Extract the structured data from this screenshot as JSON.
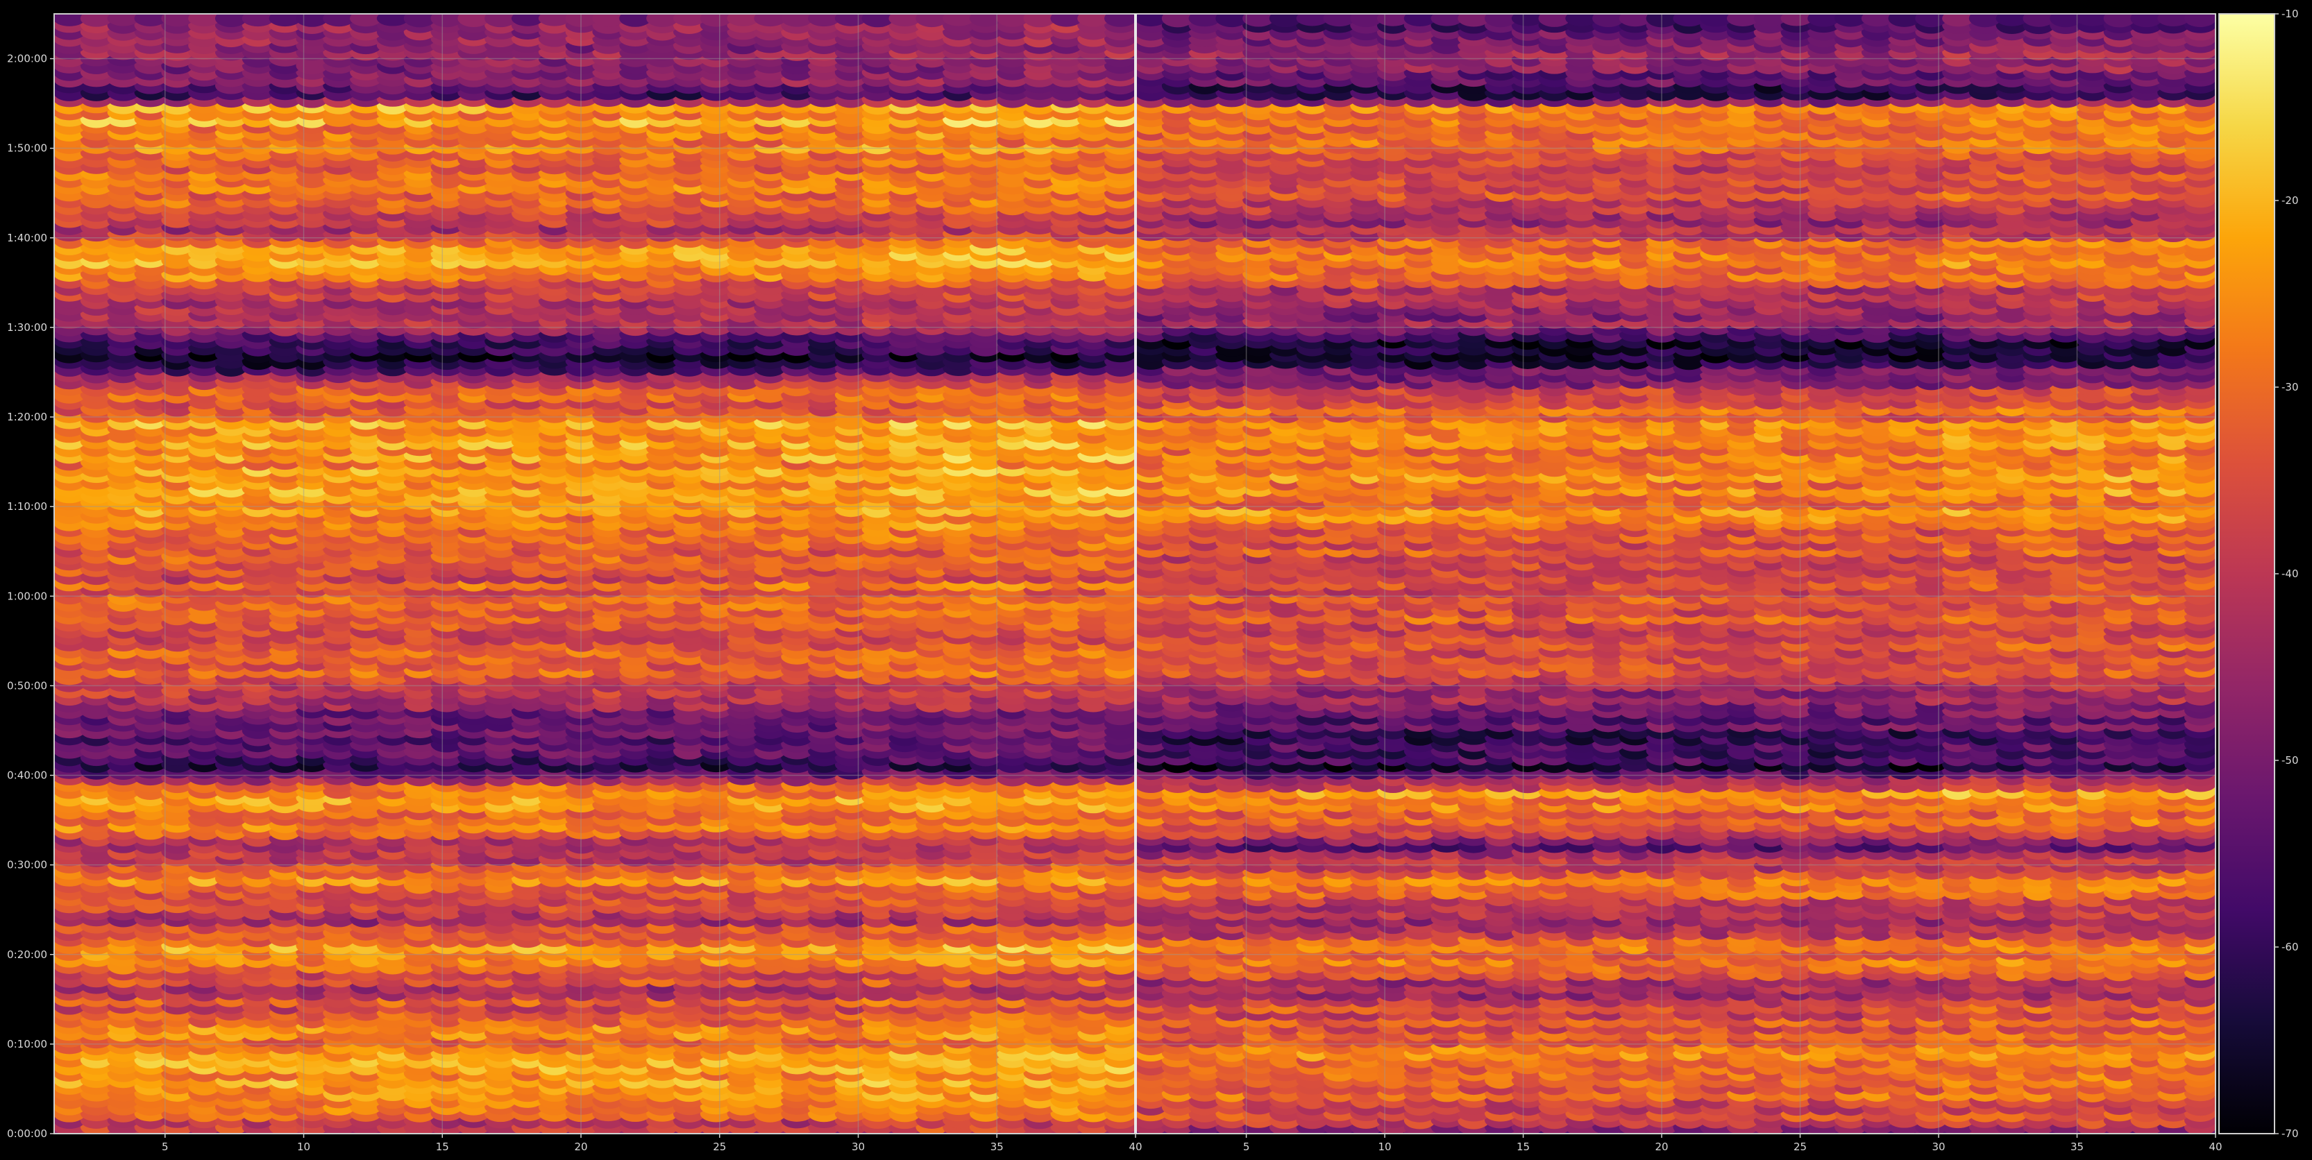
{
  "chart_data": {
    "type": "heatmap",
    "mark_style": "ellipse-grid",
    "colormap": "inferno",
    "background": "#000000",
    "grid": true,
    "panels": [
      {
        "xlim": [
          1,
          40
        ],
        "x_ticks": [
          5,
          10,
          15,
          20,
          25,
          30,
          35,
          40
        ],
        "x_tick_labels": [
          "5",
          "10",
          "15",
          "20",
          "25",
          "30",
          "35",
          "40"
        ],
        "ylim": [
          0,
          7500
        ],
        "y_ticks": [
          0,
          600,
          1200,
          1800,
          2400,
          3000,
          3600,
          4200,
          4800,
          5400,
          6000,
          6600,
          7200
        ],
        "y_tick_labels": [
          "0:00:00",
          "0:10:00",
          "0:20:00",
          "0:30:00",
          "0:40:00",
          "0:50:00",
          "1:00:00",
          "1:10:00",
          "1:20:00",
          "1:30:00",
          "1:40:00",
          "1:50:00",
          "2:00:00"
        ]
      },
      {
        "xlim": [
          1,
          40
        ],
        "x_ticks": [
          5,
          10,
          15,
          20,
          25,
          30,
          35,
          40
        ],
        "x_tick_labels": [
          "5",
          "10",
          "15",
          "20",
          "25",
          "30",
          "35",
          "40"
        ],
        "ylim": [
          0,
          7500
        ],
        "y_ticks": [
          0,
          600,
          1200,
          1800,
          2400,
          3000,
          3600,
          4200,
          4800,
          5400,
          6000,
          6600,
          7200
        ],
        "y_tick_labels": []
      }
    ],
    "colorbar": {
      "range": [
        -70,
        -10
      ],
      "ticks": [
        -70,
        -60,
        -50,
        -40,
        -30,
        -20,
        -10
      ],
      "tick_labels": [
        "-70",
        "-60",
        "-50",
        "-40",
        "-30",
        "-20",
        "-10"
      ]
    },
    "row_profile": {
      "description_values_dB_by_time": [
        [
          0,
          -45
        ],
        [
          120,
          -35
        ],
        [
          250,
          -30
        ],
        [
          400,
          -24
        ],
        [
          520,
          -26
        ],
        [
          700,
          -28
        ],
        [
          900,
          -36
        ],
        [
          1000,
          -40
        ],
        [
          1150,
          -30
        ],
        [
          1260,
          -25
        ],
        [
          1350,
          -34
        ],
        [
          1450,
          -42
        ],
        [
          1550,
          -36
        ],
        [
          1700,
          -26
        ],
        [
          1850,
          -38
        ],
        [
          1950,
          -48
        ],
        [
          2050,
          -30
        ],
        [
          2300,
          -24
        ],
        [
          2450,
          -60
        ],
        [
          2600,
          -54
        ],
        [
          2800,
          -52
        ],
        [
          2950,
          -42
        ],
        [
          3100,
          -32
        ],
        [
          3350,
          -34
        ],
        [
          3550,
          -30
        ],
        [
          3750,
          -34
        ],
        [
          3950,
          -30
        ],
        [
          4300,
          -22
        ],
        [
          4500,
          -26
        ],
        [
          4750,
          -24
        ],
        [
          5000,
          -36
        ],
        [
          5200,
          -62
        ],
        [
          5300,
          -64
        ],
        [
          5400,
          -44
        ],
        [
          5650,
          -38
        ],
        [
          5900,
          -20
        ],
        [
          6100,
          -44
        ],
        [
          6300,
          -30
        ],
        [
          6500,
          -32
        ],
        [
          6900,
          -22
        ],
        [
          6950,
          -65
        ],
        [
          7050,
          -52
        ],
        [
          7250,
          -40
        ],
        [
          7350,
          -50
        ]
      ]
    }
  }
}
